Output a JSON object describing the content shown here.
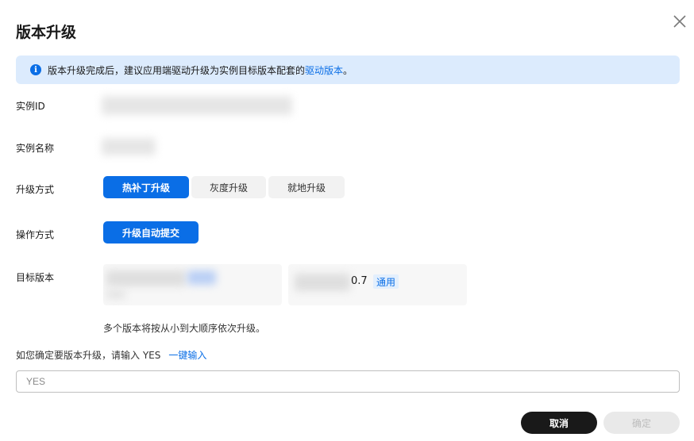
{
  "dialog": {
    "title": "版本升级"
  },
  "notice": {
    "text": "版本升级完成后，建议应用端驱动升级为实例目标版本配套的",
    "link": "驱动版本",
    "suffix": "。"
  },
  "fields": {
    "instance_id_label": "实例ID",
    "instance_name_label": "实例名称",
    "upgrade_mode_label": "升级方式",
    "operation_mode_label": "操作方式",
    "target_version_label": "目标版本"
  },
  "upgrade_modes": [
    "热补丁升级",
    "灰度升级",
    "就地升级"
  ],
  "operation_mode": {
    "value": "升级自动提交"
  },
  "target_version": {
    "suffix": "0.7",
    "badge": "通用",
    "hint": "多个版本将按从小到大顺序依次升级。"
  },
  "confirm": {
    "text": "如您确定要版本升级，请输入 YES",
    "one_key": "一键输入",
    "placeholder": "YES"
  },
  "footer": {
    "cancel": "取消",
    "ok": "确定"
  },
  "colors": {
    "accent": "#0a6ee6",
    "notice_bg": "#dcebfd",
    "dark_button": "#191919"
  }
}
